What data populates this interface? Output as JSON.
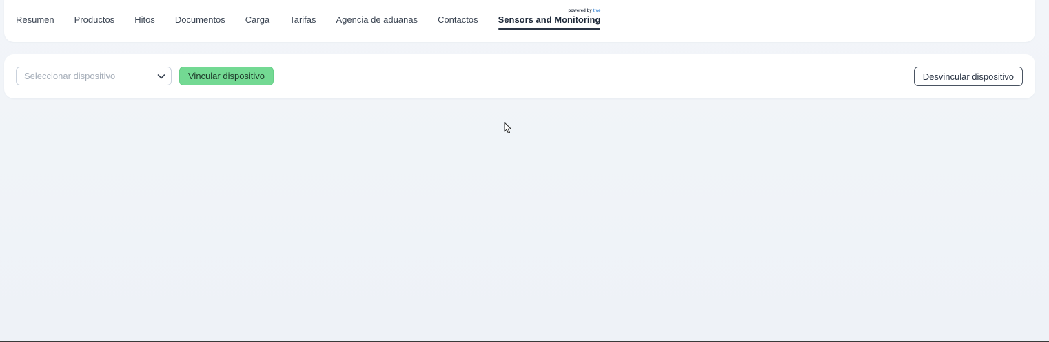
{
  "tabs": [
    {
      "label": "Resumen",
      "active": false
    },
    {
      "label": "Productos",
      "active": false
    },
    {
      "label": "Hitos",
      "active": false
    },
    {
      "label": "Documentos",
      "active": false
    },
    {
      "label": "Carga",
      "active": false
    },
    {
      "label": "Tarifas",
      "active": false
    },
    {
      "label": "Agencia de aduanas",
      "active": false
    },
    {
      "label": "Contactos",
      "active": false
    },
    {
      "label": "Sensors and Monitoring",
      "active": true
    }
  ],
  "powered_by": {
    "prefix": "powered by",
    "brand": "tive"
  },
  "toolbar": {
    "device_select_placeholder": "Seleccionar dispositivo",
    "link_button": "Vincular dispositivo",
    "unlink_button": "Desvincular dispositivo"
  },
  "colors": {
    "link_button_bg": "#73d993",
    "page_bg": "#f0f3f8",
    "card_bg": "#ffffff",
    "active_tab": "#1f2a3a",
    "brand_accent": "#4a90d9"
  },
  "icons": {
    "select_chevron": "chevron-down-icon",
    "cursor": "mouse-pointer-icon"
  }
}
